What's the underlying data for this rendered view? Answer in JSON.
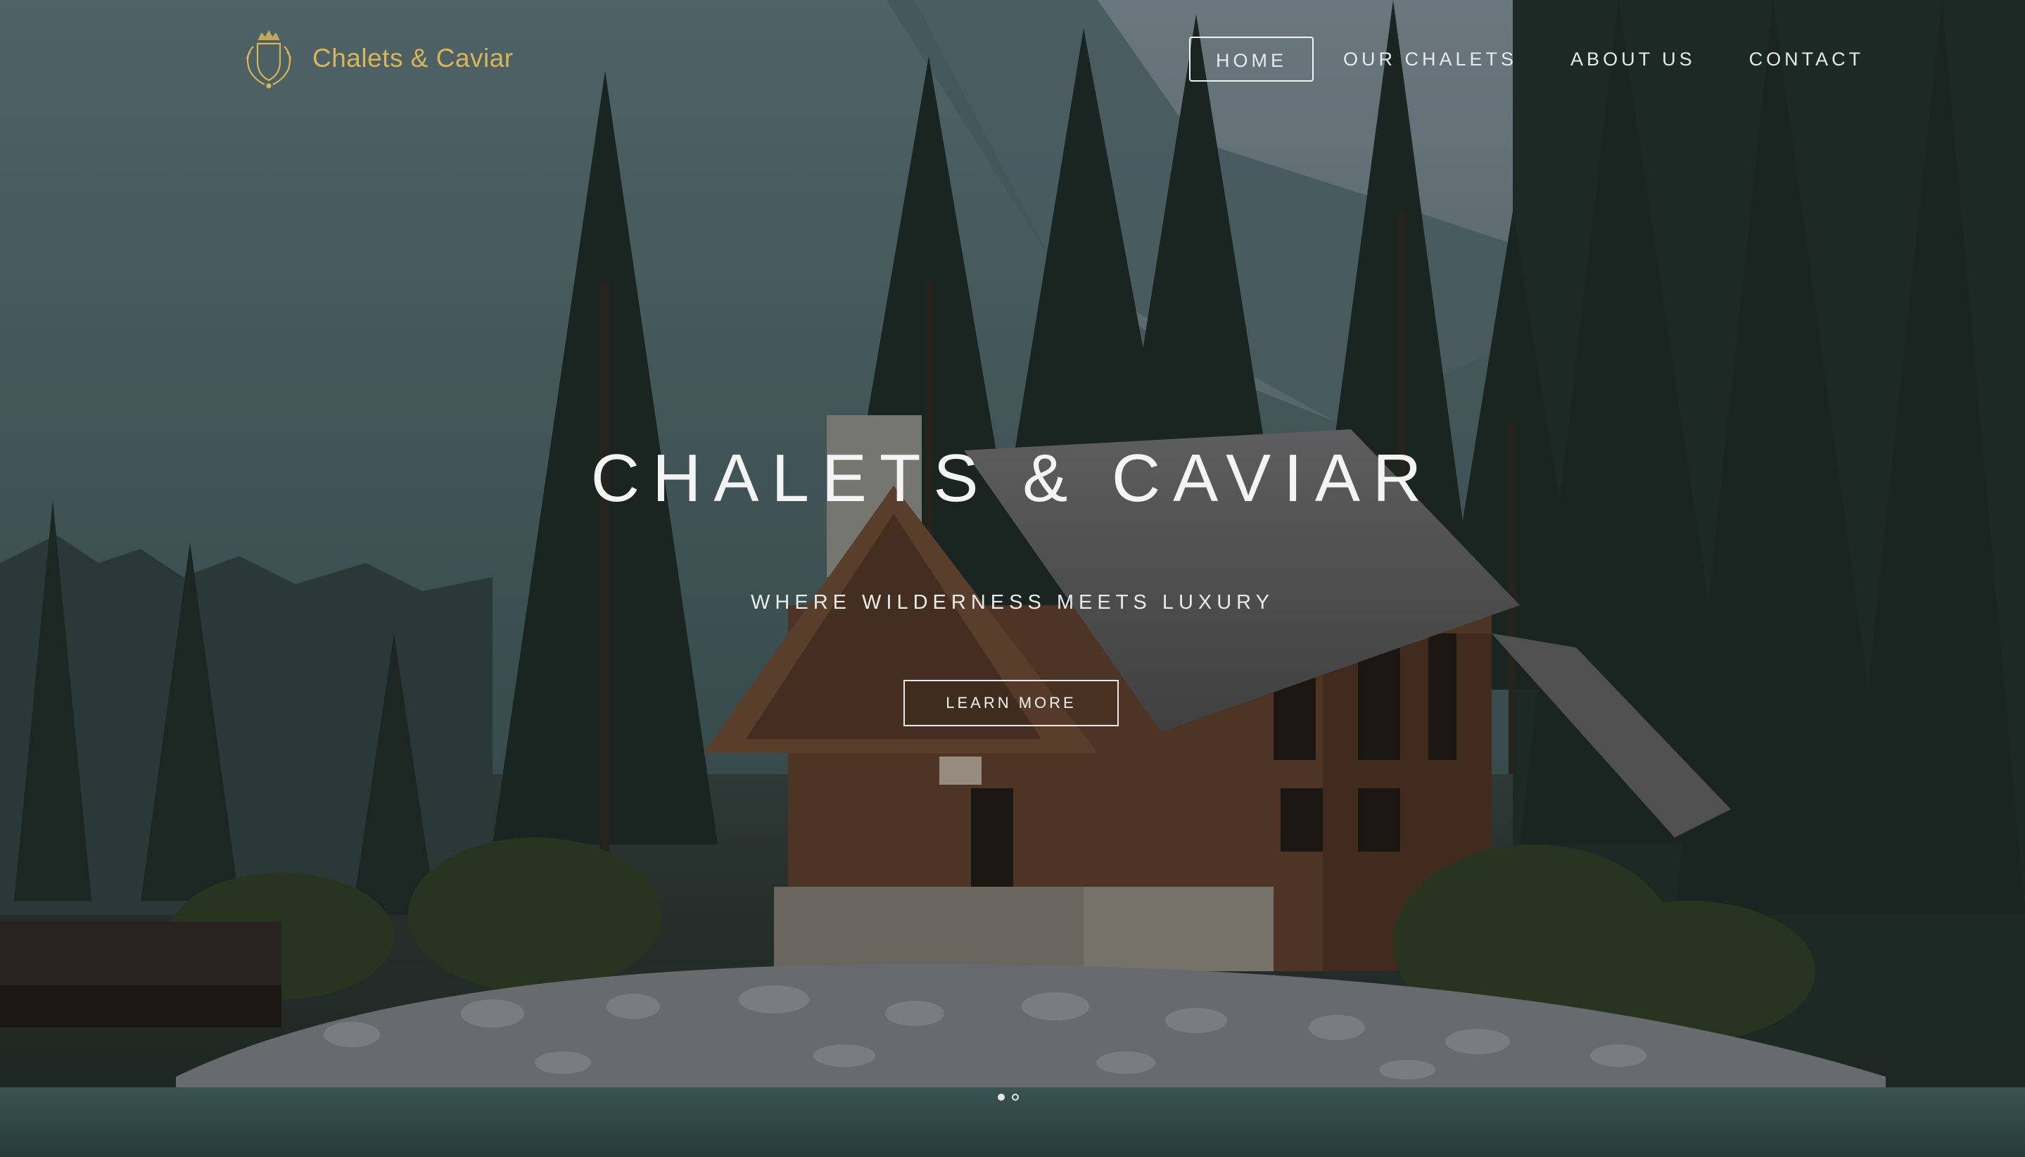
{
  "brand": {
    "name": "Chalets & Caviar",
    "logo_icon": "crest-crown-icon",
    "accent_color": "#d8b45a"
  },
  "nav": {
    "items": [
      {
        "label": "HOME",
        "active": true
      },
      {
        "label": "OUR CHALETS",
        "active": false
      },
      {
        "label": "ABOUT US",
        "active": false
      },
      {
        "label": "CONTACT",
        "active": false
      }
    ]
  },
  "hero": {
    "title": "CHALETS & CAVIAR",
    "subtitle": "WHERE WILDERNESS MEETS LUXURY",
    "cta_label": "LEARN MORE",
    "slides_total": 2,
    "slide_active_index": 0
  }
}
